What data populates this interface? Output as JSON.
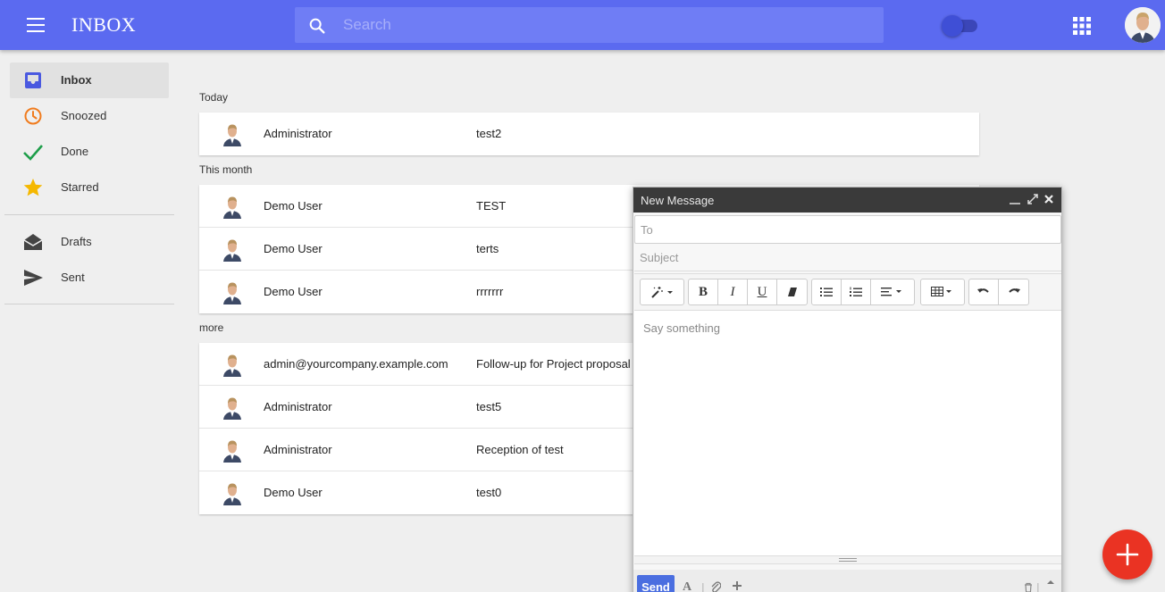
{
  "header": {
    "title": "INBOX",
    "search_placeholder": "Search",
    "colors": {
      "bar": "#5b6af0",
      "search": "#6f7df5"
    }
  },
  "sidebar": {
    "items": [
      {
        "label": "Inbox",
        "icon": "inbox-icon",
        "active": true,
        "color": "#4a59e0"
      },
      {
        "label": "Snoozed",
        "icon": "clock-icon",
        "color": "#f07b1d"
      },
      {
        "label": "Done",
        "icon": "check-icon",
        "color": "#1e9e4a"
      },
      {
        "label": "Starred",
        "icon": "star-icon",
        "color": "#f5b800"
      },
      {
        "label": "Drafts",
        "icon": "drafts-icon",
        "color": "#444444"
      },
      {
        "label": "Sent",
        "icon": "send-icon",
        "color": "#444444"
      }
    ]
  },
  "sections": [
    {
      "label": "Today",
      "messages": [
        {
          "from": "Administrator",
          "subject": "test2"
        }
      ]
    },
    {
      "label": "This month",
      "messages": [
        {
          "from": "Demo User",
          "subject": "TEST"
        },
        {
          "from": "Demo User",
          "subject": "terts"
        },
        {
          "from": "Demo User",
          "subject": "rrrrrrr"
        }
      ]
    },
    {
      "label": "more",
      "messages": [
        {
          "from": "admin@yourcompany.example.com",
          "subject": "Follow-up for Project proposal"
        },
        {
          "from": "Administrator",
          "subject": "test5"
        },
        {
          "from": "Administrator",
          "subject": "Reception of test"
        },
        {
          "from": "Demo User",
          "subject": "test0"
        }
      ]
    }
  ],
  "compose": {
    "title": "New Message",
    "to_placeholder": "To",
    "subject_placeholder": "Subject",
    "body_placeholder": "Say something",
    "send_label": "Send",
    "toolbar": {
      "bold": "B",
      "italic": "I",
      "underline": "U"
    }
  },
  "fab": {
    "label": "+",
    "color": "#ea3323"
  }
}
